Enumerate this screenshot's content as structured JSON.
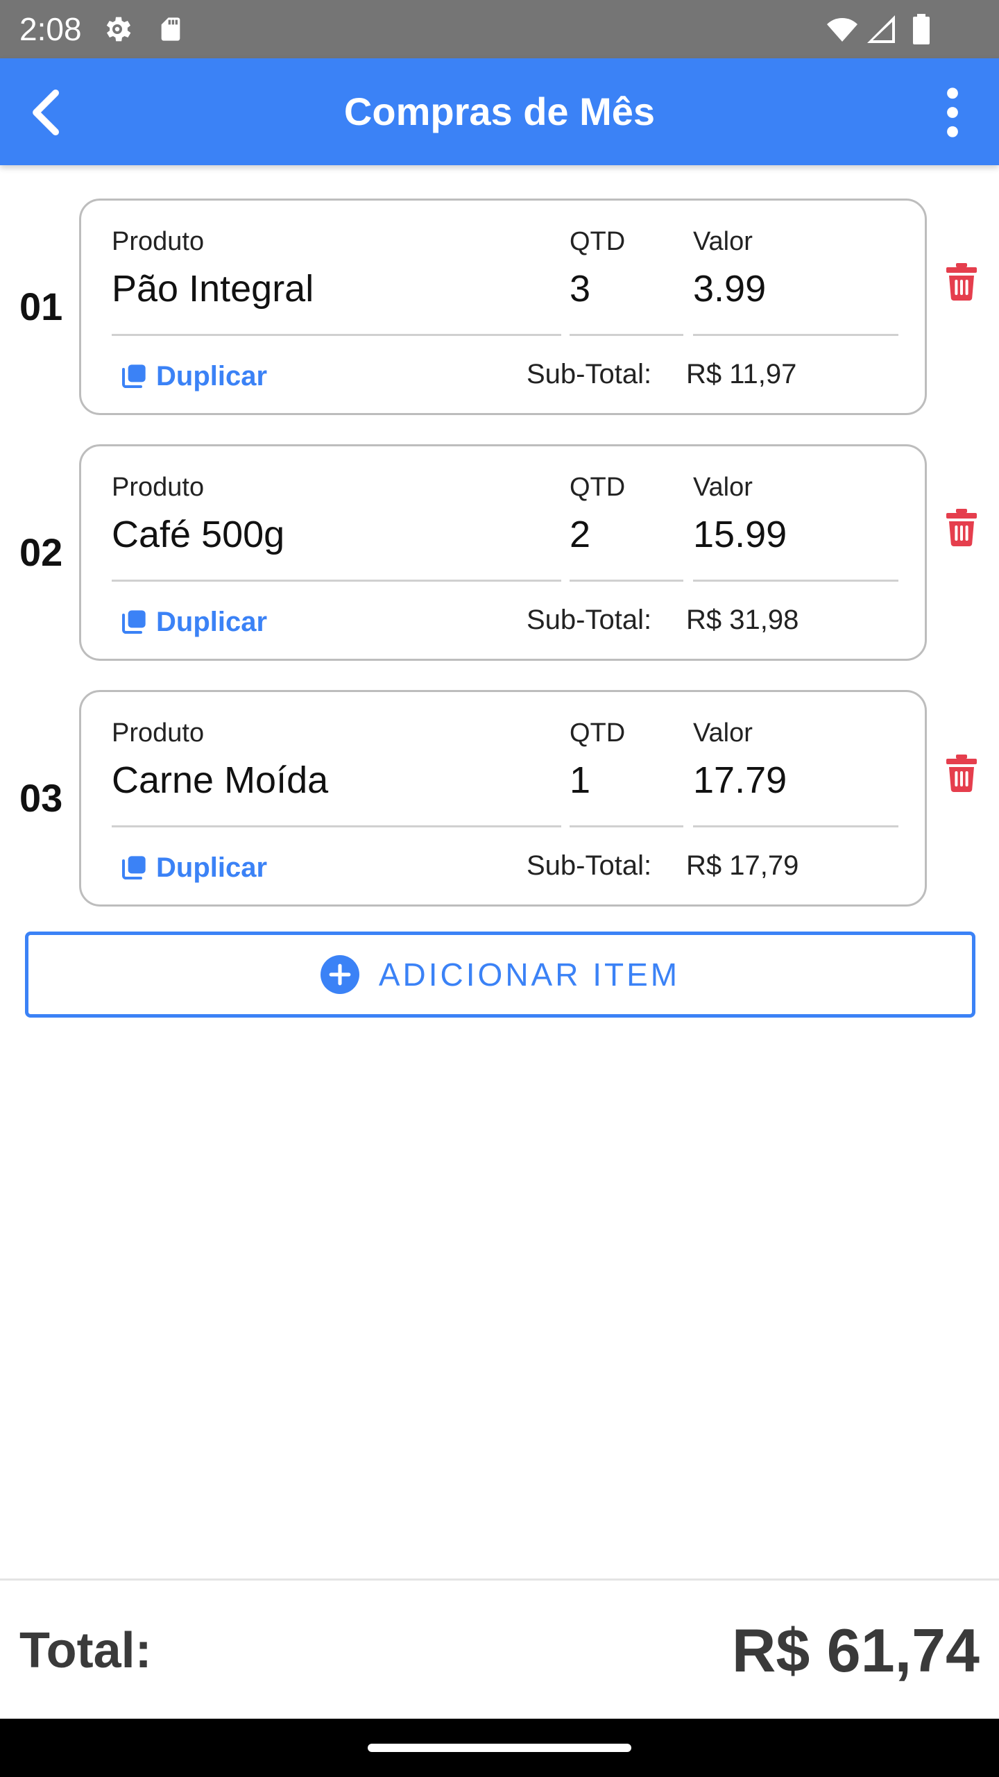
{
  "status_bar": {
    "time": "2:08",
    "icons": [
      "settings-icon",
      "sd-card-icon",
      "wifi-icon",
      "signal-icon",
      "battery-icon"
    ]
  },
  "app_bar": {
    "title": "Compras de Mês",
    "back_icon": "chevron-left-icon",
    "menu_icon": "more-vertical-icon",
    "color": "#3b82f6"
  },
  "items": [
    {
      "index": "01",
      "produto_label": "Produto",
      "produto": "Pão Integral",
      "qtd_label": "QTD",
      "qtd": "3",
      "valor_label": "Valor",
      "valor": "3.99",
      "duplicate_label": "Duplicar",
      "subtotal_label": "Sub-Total:",
      "subtotal": "R$ 11,97"
    },
    {
      "index": "02",
      "produto_label": "Produto",
      "produto": "Café 500g",
      "qtd_label": "QTD",
      "qtd": "2",
      "valor_label": "Valor",
      "valor": "15.99",
      "duplicate_label": "Duplicar",
      "subtotal_label": "Sub-Total:",
      "subtotal": "R$ 31,98"
    },
    {
      "index": "03",
      "produto_label": "Produto",
      "produto": "Carne Moída",
      "qtd_label": "QTD",
      "qtd": "1",
      "valor_label": "Valor",
      "valor": "17.79",
      "duplicate_label": "Duplicar",
      "subtotal_label": "Sub-Total:",
      "subtotal": "R$ 17,79"
    }
  ],
  "add_item": {
    "label": "ADICIONAR ITEM",
    "icon": "add-circle-icon"
  },
  "footer": {
    "total_label": "Total:",
    "total_value": "R$ 61,74"
  },
  "colors": {
    "accent": "#3b82f6",
    "delete": "#e53e4d",
    "text": "#111111",
    "total_text": "#3a3a3a"
  }
}
